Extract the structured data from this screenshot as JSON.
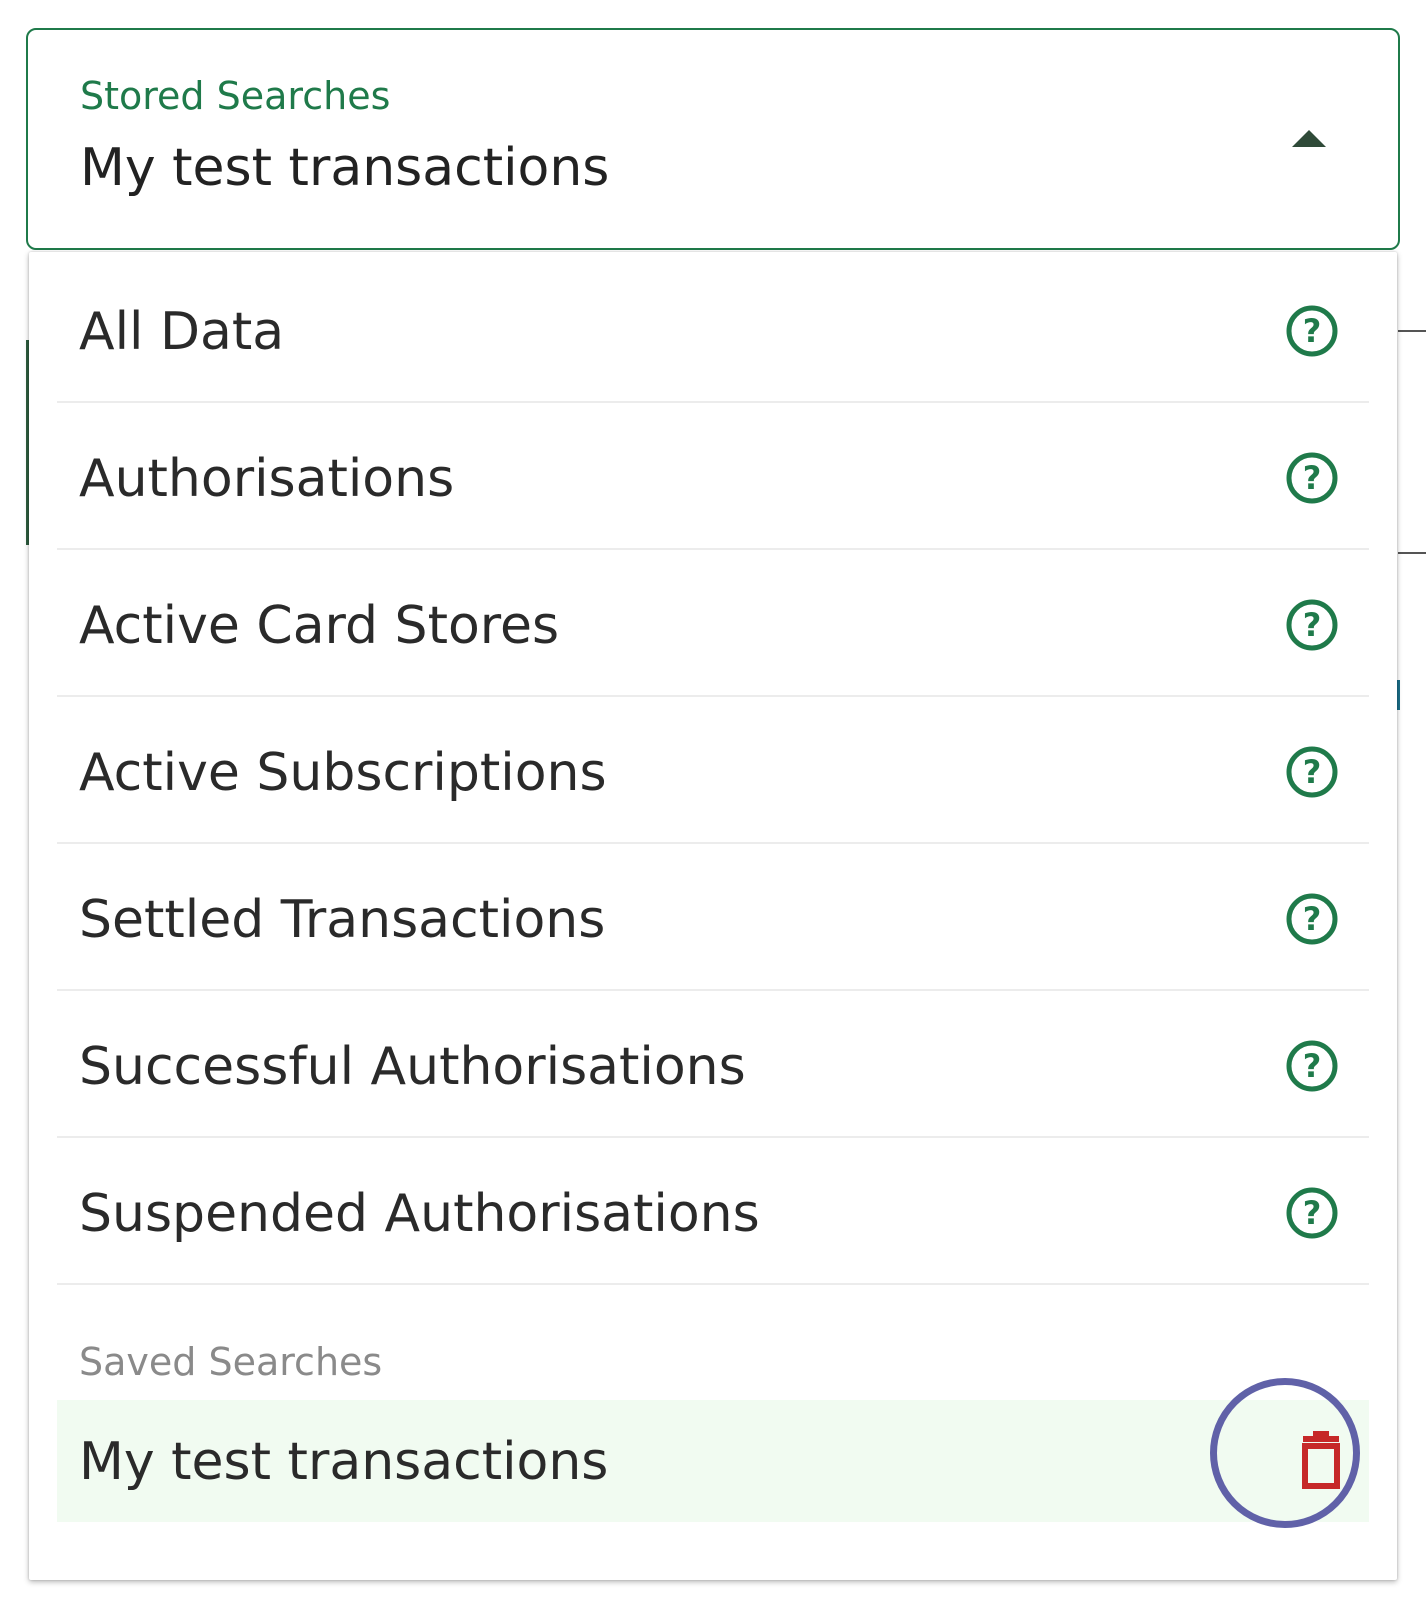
{
  "select": {
    "label": "Stored Searches",
    "value": "My test transactions",
    "caret_icon": "caret-up-icon"
  },
  "menu": {
    "options": [
      {
        "label": "All Data",
        "icon": "help-circle-icon"
      },
      {
        "label": "Authorisations",
        "icon": "help-circle-icon"
      },
      {
        "label": "Active Card Stores",
        "icon": "help-circle-icon"
      },
      {
        "label": "Active Subscriptions",
        "icon": "help-circle-icon"
      },
      {
        "label": "Settled Transactions",
        "icon": "help-circle-icon"
      },
      {
        "label": "Successful Authorisations",
        "icon": "help-circle-icon"
      },
      {
        "label": "Suspended Authorisations",
        "icon": "help-circle-icon"
      }
    ],
    "group_header": "Saved Searches",
    "saved": [
      {
        "label": "My test transactions",
        "icon": "trash-icon",
        "selected": true
      }
    ]
  },
  "colors": {
    "accent": "#1f7a4a",
    "delete": "#c62828",
    "selected_bg": "#f1fbf1",
    "highlight_ring": "#6061a8"
  }
}
